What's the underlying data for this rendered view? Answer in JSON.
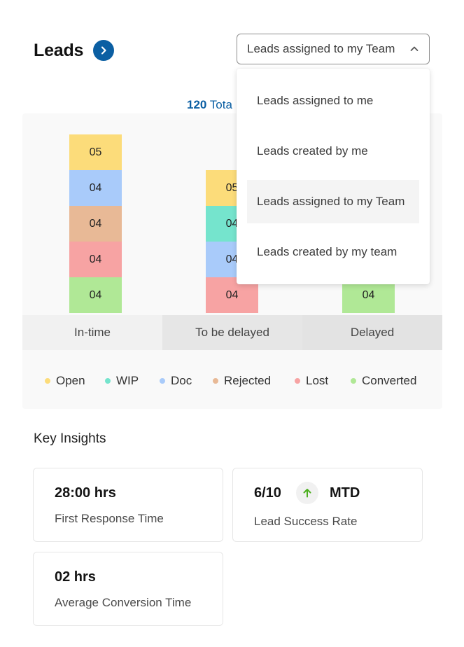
{
  "header": {
    "title": "Leads"
  },
  "filter": {
    "selected": "Leads assigned to my Team",
    "options": [
      "Leads assigned to me",
      "Leads created by me",
      "Leads assigned to my Team",
      "Leads created by my team"
    ],
    "selected_index": 2
  },
  "total": {
    "count": "120",
    "label": "Tota"
  },
  "colors": {
    "open": "#fcdc7a",
    "wip": "#75e4cd",
    "doc": "#a9cbfa",
    "rejected": "#e8b996",
    "lost": "#f7a3a3",
    "converted": "#b0e896",
    "accent": "#0b5fa3",
    "arrow_up": "#4caf1f"
  },
  "chart_data": {
    "type": "bar",
    "stacked": true,
    "categories": [
      "In-time",
      "To be delayed",
      "Delayed"
    ],
    "segments": [
      {
        "category": "In-time",
        "status": "Converted",
        "label": "04"
      },
      {
        "category": "In-time",
        "status": "Lost",
        "label": "04"
      },
      {
        "category": "In-time",
        "status": "Rejected",
        "label": "04"
      },
      {
        "category": "In-time",
        "status": "Doc",
        "label": "04"
      },
      {
        "category": "In-time",
        "status": "Open",
        "label": "05"
      },
      {
        "category": "To be delayed",
        "status": "Lost",
        "label": "04"
      },
      {
        "category": "To be delayed",
        "status": "Doc",
        "label": "04"
      },
      {
        "category": "To be delayed",
        "status": "WIP",
        "label": "04"
      },
      {
        "category": "To be delayed",
        "status": "Open",
        "label": "05"
      },
      {
        "category": "Delayed",
        "status": "Converted",
        "label": "04"
      }
    ],
    "legend": [
      "Open",
      "WIP",
      "Doc",
      "Rejected",
      "Lost",
      "Converted"
    ]
  },
  "insights": {
    "title": "Key Insights",
    "cards": [
      {
        "metric": "28:00 hrs",
        "caption": "First Response Time"
      },
      {
        "metric": "6/10",
        "badge": "MTD",
        "caption": "Lead Success Rate"
      },
      {
        "metric": "02 hrs",
        "caption": "Average Conversion Time"
      }
    ]
  }
}
